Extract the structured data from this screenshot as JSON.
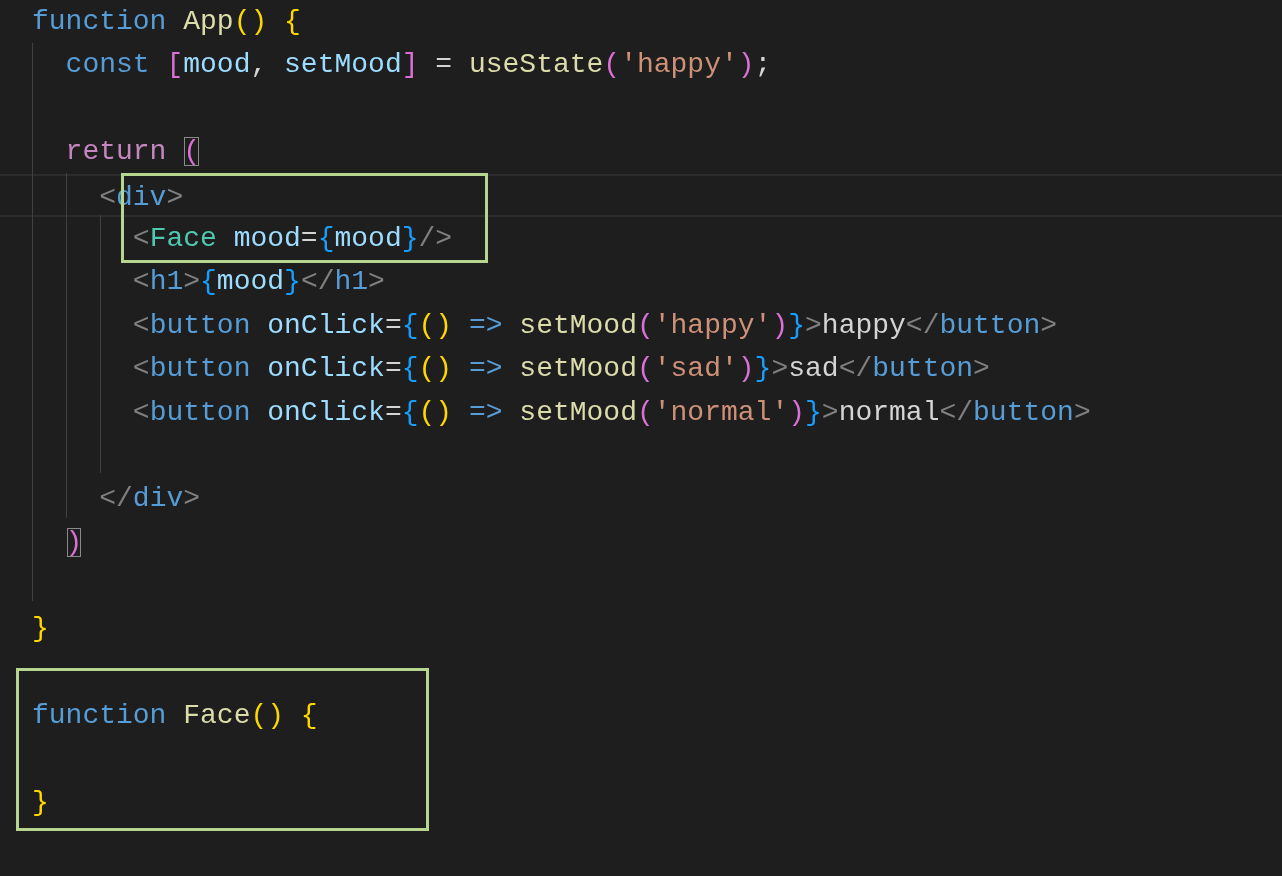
{
  "editor": {
    "lines": [
      {
        "kind": "code",
        "tokens": [
          {
            "text": "function ",
            "kind": "keyword"
          },
          {
            "text": "App",
            "kind": "function"
          },
          {
            "text": "()",
            "kind": "bracket1"
          },
          {
            "text": " {",
            "kind": "bracket1"
          }
        ]
      },
      {
        "kind": "code",
        "tokens": [
          {
            "text": "  const ",
            "kind": "keyword"
          },
          {
            "text": "[",
            "kind": "bracket2"
          },
          {
            "text": "mood",
            "kind": "variable"
          },
          {
            "text": ", ",
            "kind": "text"
          },
          {
            "text": "setMood",
            "kind": "variable"
          },
          {
            "text": "]",
            "kind": "bracket2"
          },
          {
            "text": " = ",
            "kind": "text"
          },
          {
            "text": "useState",
            "kind": "function"
          },
          {
            "text": "(",
            "kind": "bracket2"
          },
          {
            "text": "'happy'",
            "kind": "string"
          },
          {
            "text": ")",
            "kind": "bracket2"
          },
          {
            "text": ";",
            "kind": "text"
          }
        ]
      },
      {
        "kind": "blank"
      },
      {
        "kind": "code",
        "tokens": [
          {
            "text": "  return ",
            "kind": "control"
          },
          {
            "text": "(",
            "kind": "bracket2",
            "matched": true
          }
        ]
      },
      {
        "kind": "code",
        "current": true,
        "tokens": [
          {
            "text": "    <",
            "kind": "tagpunct"
          },
          {
            "text": "div",
            "kind": "tag"
          },
          {
            "text": ">",
            "kind": "tagpunct"
          }
        ]
      },
      {
        "kind": "code",
        "tokens": [
          {
            "text": "      <",
            "kind": "tagpunct"
          },
          {
            "text": "Face",
            "kind": "component"
          },
          {
            "text": " mood",
            "kind": "variable"
          },
          {
            "text": "=",
            "kind": "text"
          },
          {
            "text": "{",
            "kind": "bracket3"
          },
          {
            "text": "mood",
            "kind": "variable"
          },
          {
            "text": "}",
            "kind": "bracket3"
          },
          {
            "text": "/>",
            "kind": "tagpunct"
          }
        ]
      },
      {
        "kind": "code",
        "tokens": [
          {
            "text": "      <",
            "kind": "tagpunct"
          },
          {
            "text": "h1",
            "kind": "tag"
          },
          {
            "text": ">",
            "kind": "tagpunct"
          },
          {
            "text": "{",
            "kind": "bracket3"
          },
          {
            "text": "mood",
            "kind": "variable"
          },
          {
            "text": "}",
            "kind": "bracket3"
          },
          {
            "text": "</",
            "kind": "tagpunct"
          },
          {
            "text": "h1",
            "kind": "tag"
          },
          {
            "text": ">",
            "kind": "tagpunct"
          }
        ]
      },
      {
        "kind": "code",
        "tokens": [
          {
            "text": "      <",
            "kind": "tagpunct"
          },
          {
            "text": "button",
            "kind": "tag"
          },
          {
            "text": " onClick",
            "kind": "variable"
          },
          {
            "text": "=",
            "kind": "text"
          },
          {
            "text": "{",
            "kind": "bracket3"
          },
          {
            "text": "()",
            "kind": "bracket1"
          },
          {
            "text": " => ",
            "kind": "keyword"
          },
          {
            "text": "setMood",
            "kind": "function"
          },
          {
            "text": "(",
            "kind": "bracket2"
          },
          {
            "text": "'happy'",
            "kind": "string"
          },
          {
            "text": ")",
            "kind": "bracket2"
          },
          {
            "text": "}",
            "kind": "bracket3"
          },
          {
            "text": ">",
            "kind": "tagpunct"
          },
          {
            "text": "happy",
            "kind": "text"
          },
          {
            "text": "</",
            "kind": "tagpunct"
          },
          {
            "text": "button",
            "kind": "tag"
          },
          {
            "text": ">",
            "kind": "tagpunct"
          }
        ]
      },
      {
        "kind": "code",
        "tokens": [
          {
            "text": "      <",
            "kind": "tagpunct"
          },
          {
            "text": "button",
            "kind": "tag"
          },
          {
            "text": " onClick",
            "kind": "variable"
          },
          {
            "text": "=",
            "kind": "text"
          },
          {
            "text": "{",
            "kind": "bracket3"
          },
          {
            "text": "()",
            "kind": "bracket1"
          },
          {
            "text": " => ",
            "kind": "keyword"
          },
          {
            "text": "setMood",
            "kind": "function"
          },
          {
            "text": "(",
            "kind": "bracket2"
          },
          {
            "text": "'sad'",
            "kind": "string"
          },
          {
            "text": ")",
            "kind": "bracket2"
          },
          {
            "text": "}",
            "kind": "bracket3"
          },
          {
            "text": ">",
            "kind": "tagpunct"
          },
          {
            "text": "sad",
            "kind": "text"
          },
          {
            "text": "</",
            "kind": "tagpunct"
          },
          {
            "text": "button",
            "kind": "tag"
          },
          {
            "text": ">",
            "kind": "tagpunct"
          }
        ]
      },
      {
        "kind": "code",
        "tokens": [
          {
            "text": "      <",
            "kind": "tagpunct"
          },
          {
            "text": "button",
            "kind": "tag"
          },
          {
            "text": " onClick",
            "kind": "variable"
          },
          {
            "text": "=",
            "kind": "text"
          },
          {
            "text": "{",
            "kind": "bracket3"
          },
          {
            "text": "()",
            "kind": "bracket1"
          },
          {
            "text": " => ",
            "kind": "keyword"
          },
          {
            "text": "setMood",
            "kind": "function"
          },
          {
            "text": "(",
            "kind": "bracket2"
          },
          {
            "text": "'normal'",
            "kind": "string"
          },
          {
            "text": ")",
            "kind": "bracket2"
          },
          {
            "text": "}",
            "kind": "bracket3"
          },
          {
            "text": ">",
            "kind": "tagpunct"
          },
          {
            "text": "normal",
            "kind": "text"
          },
          {
            "text": "</",
            "kind": "tagpunct"
          },
          {
            "text": "button",
            "kind": "tag"
          },
          {
            "text": ">",
            "kind": "tagpunct"
          }
        ]
      },
      {
        "kind": "blank"
      },
      {
        "kind": "code",
        "tokens": [
          {
            "text": "    </",
            "kind": "tagpunct"
          },
          {
            "text": "div",
            "kind": "tag"
          },
          {
            "text": ">",
            "kind": "tagpunct"
          }
        ]
      },
      {
        "kind": "code",
        "tokens": [
          {
            "text": "  )",
            "kind": "bracket2",
            "matched": true
          }
        ]
      },
      {
        "kind": "blank"
      },
      {
        "kind": "code",
        "tokens": [
          {
            "text": "}",
            "kind": "bracket1"
          }
        ]
      },
      {
        "kind": "blank"
      },
      {
        "kind": "code",
        "tokens": [
          {
            "text": "function ",
            "kind": "keyword"
          },
          {
            "text": "Face",
            "kind": "function"
          },
          {
            "text": "()",
            "kind": "bracket1"
          },
          {
            "text": " {",
            "kind": "bracket1"
          }
        ]
      },
      {
        "kind": "blank"
      },
      {
        "kind": "code",
        "tokens": [
          {
            "text": "}",
            "kind": "bracket1"
          }
        ]
      }
    ]
  }
}
